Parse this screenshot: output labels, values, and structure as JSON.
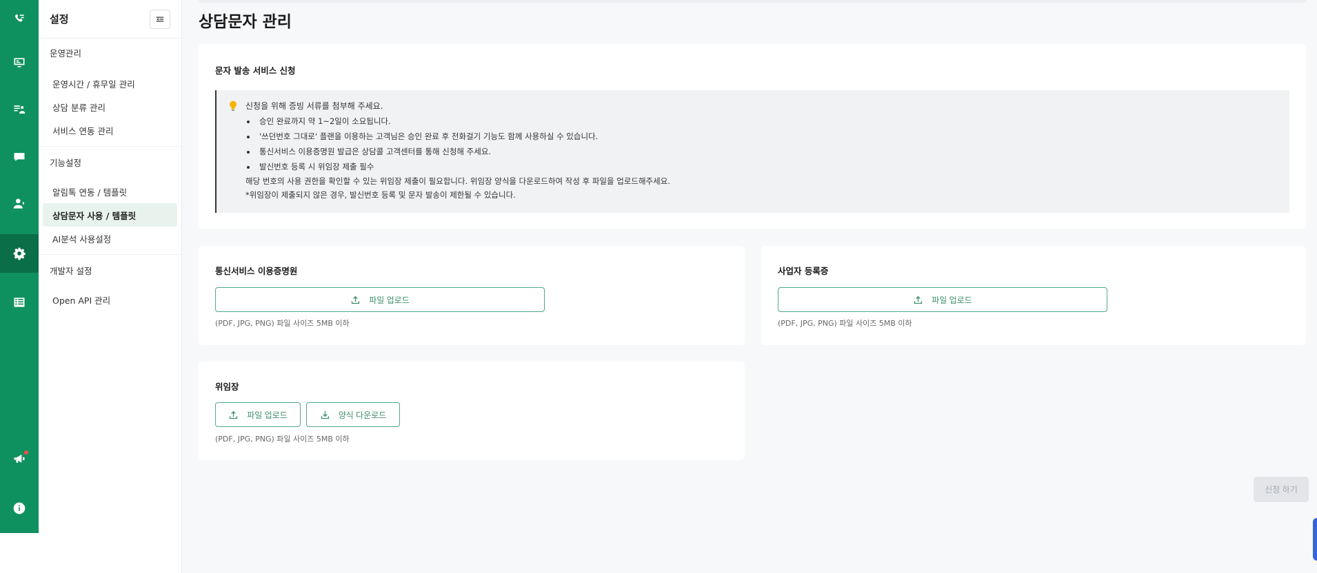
{
  "colors": {
    "brand": "#0f915f",
    "brand_dark": "#0a6e48",
    "accent_border": "#4faa84",
    "sidebar_active_bg": "#e8f3ee",
    "alert_dot": "#ff4d4f"
  },
  "rail": {
    "items": [
      {
        "icon": "call-list-icon"
      },
      {
        "icon": "monitor-icon"
      },
      {
        "icon": "user-list-icon"
      },
      {
        "icon": "message-icon"
      },
      {
        "icon": "user-icon"
      },
      {
        "icon": "gear-icon",
        "active": true
      },
      {
        "icon": "table-icon"
      },
      {
        "icon": "megaphone-icon",
        "badge": true
      },
      {
        "icon": "info-icon"
      }
    ]
  },
  "sidebar": {
    "title": "설정",
    "sections": [
      {
        "title": "운영관리",
        "items": [
          "운영시간 / 휴무일 관리",
          "상담 분류 관리",
          "서비스 연동 관리"
        ]
      },
      {
        "title": "기능설정",
        "items": [
          "알림톡 연동 / 템플릿",
          "상담문자 사용 / 템플릿",
          "AI분석 사용설정"
        ],
        "active_item": "상담문자 사용 / 템플릿"
      },
      {
        "title": "개발자 설정",
        "items": [
          "Open API 관리"
        ]
      }
    ]
  },
  "main": {
    "page_title": "상담문자 관리",
    "notice": {
      "title": "문자 발송 서비스 신청",
      "lead": "신청을 위해 증빙 서류를 첨부해 주세요.",
      "bullets": [
        "승인 완료까지 약 1~2일이 소요됩니다.",
        "'쓰던번호 그대로' 플랜을 이용하는 고객님은 승인 완료 후 전화걸기 기능도 함께 사용하실 수 있습니다.",
        "통신서비스 이용증명원 발급은 상담콜 고객센터를 통해 신청해 주세요.",
        "발신번호 등록 시 위임장 제출 필수"
      ],
      "foot1": "해당 번호의 사용 권한을 확인할 수 있는 위임장 제출이 필요합니다. 위임장 양식을 다운로드하여 작성 후 파일을 업로드해주세요.",
      "foot2": "*위임장이 제출되지 않은 경우, 발신번호 등록 및 문자 발송이 제한될 수 있습니다."
    },
    "telecom": {
      "title": "통신서비스 이용증명원",
      "upload_label": "파일 업로드",
      "hint": "(PDF, JPG, PNG) 파일 사이즈 5MB 이하"
    },
    "business": {
      "title": "사업자 등록증",
      "upload_label": "파일 업로드",
      "hint": "(PDF, JPG, PNG) 파일 사이즈 5MB 이하"
    },
    "proxy": {
      "title": "위임장",
      "upload_label": "파일 업로드",
      "download_label": "양식 다운로드",
      "hint": "(PDF, JPG, PNG) 파일 사이즈 5MB 이하"
    },
    "submit_label": "신청 하기"
  }
}
